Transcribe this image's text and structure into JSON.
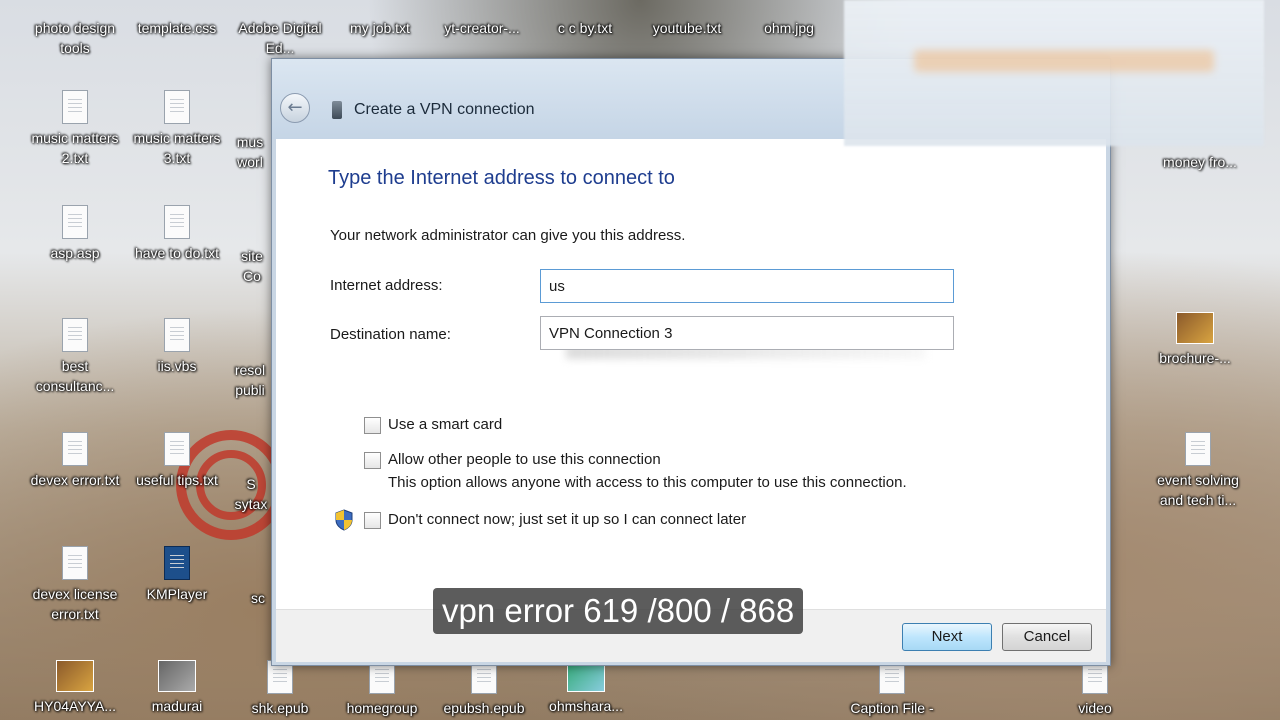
{
  "desktop": {
    "icons": [
      {
        "label": "photo design tools",
        "type": "folder"
      },
      {
        "label": "template.css",
        "type": "file"
      },
      {
        "label": "Adobe Digital Ed...",
        "type": "app"
      },
      {
        "label": "my job.txt",
        "type": "file"
      },
      {
        "label": "yt-creator-...",
        "type": "file"
      },
      {
        "label": "c c by.txt",
        "type": "file"
      },
      {
        "label": "youtube.txt",
        "type": "file"
      },
      {
        "label": "ohm.jpg",
        "type": "image"
      },
      {
        "label": "music matters 2.txt",
        "type": "file"
      },
      {
        "label": "music matters 3.txt",
        "type": "file"
      },
      {
        "label": "mus worl",
        "type": "file"
      },
      {
        "label": "money fro...",
        "type": "file"
      },
      {
        "label": "asp.asp",
        "type": "file"
      },
      {
        "label": "have to do.txt",
        "type": "file"
      },
      {
        "label": "site Co",
        "type": "file"
      },
      {
        "label": "best consultanc...",
        "type": "file"
      },
      {
        "label": "iis.vbs",
        "type": "script"
      },
      {
        "label": "resol publi",
        "type": "file"
      },
      {
        "label": "brochure-...",
        "type": "image"
      },
      {
        "label": "devex error.txt",
        "type": "file"
      },
      {
        "label": "useful tips.txt",
        "type": "file"
      },
      {
        "label": "S sytax",
        "type": "file"
      },
      {
        "label": "event solving and tech ti...",
        "type": "file"
      },
      {
        "label": "devex license error.txt",
        "type": "file"
      },
      {
        "label": "KMPlayer",
        "type": "app"
      },
      {
        "label": "sc",
        "type": "file"
      },
      {
        "label": "HY04AYYA...",
        "type": "image"
      },
      {
        "label": "madurai",
        "type": "image"
      },
      {
        "label": "shk.epub",
        "type": "file"
      },
      {
        "label": "homegroup",
        "type": "file"
      },
      {
        "label": "epubsh.epub",
        "type": "file"
      },
      {
        "label": "ohmshara...",
        "type": "image"
      },
      {
        "label": "Caption File -",
        "type": "file"
      },
      {
        "label": "video",
        "type": "file"
      }
    ]
  },
  "dialog": {
    "title": "Create a VPN connection",
    "heading": "Type the Internet address to connect to",
    "subtext": "Your network administrator can give you this address.",
    "internet_address_label": "Internet address:",
    "internet_address_value": "us",
    "destination_name_label": "Destination name:",
    "destination_name_value": "VPN Connection 3",
    "options": {
      "smart_card": "Use a smart card",
      "allow_others": "Allow other people to use this connection",
      "allow_others_desc": "This option allows anyone with access to this computer to use this connection.",
      "dont_connect": "Don't connect now; just set it up so I can connect later"
    },
    "next_label": "Next",
    "cancel_label": "Cancel"
  },
  "caption": "vpn error 619 /800 / 868"
}
